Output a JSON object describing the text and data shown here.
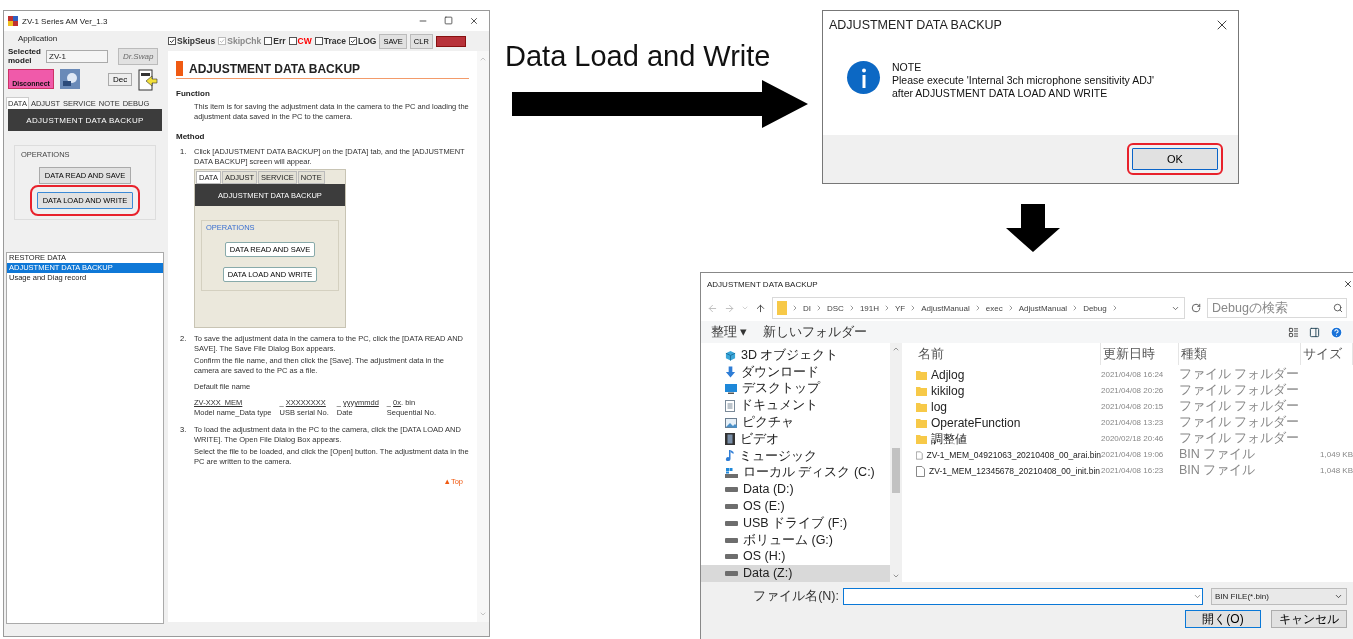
{
  "main_window": {
    "title": "ZV-1 Series AM Ver_1.3",
    "menu": [
      "Application"
    ],
    "model_label": "Selected model",
    "model_value": "ZV-1",
    "swap_button": {
      "label": "Dr.Swap",
      "disabled": true
    },
    "connect_button": "Disconnect",
    "dec_button": "Dec",
    "tabs": [
      {
        "label": "DATA",
        "selected": true
      },
      {
        "label": "ADJUST",
        "selected": false
      },
      {
        "label": "SERVICE",
        "selected": false
      },
      {
        "label": "NOTE",
        "selected": false
      },
      {
        "label": "DEBUG",
        "selected": false
      }
    ],
    "panel_header": "ADJUSTMENT DATA BACKUP",
    "group_label": "OPERATIONS",
    "operations": [
      {
        "label": "DATA READ AND SAVE",
        "highlighted": false
      },
      {
        "label": "DATA LOAD AND WRITE",
        "highlighted": true
      }
    ],
    "items": [
      {
        "label": "RESTORE DATA",
        "selected": false
      },
      {
        "label": "ADJUSTMENT DATA BACKUP",
        "selected": true
      },
      {
        "label": "Usage and Diag record",
        "selected": false
      }
    ],
    "options": [
      {
        "label": "SkipSeus",
        "checked": true,
        "disabled": false,
        "color": "#333333"
      },
      {
        "label": "SkipChk",
        "checked": true,
        "disabled": true,
        "color": "#888888"
      },
      {
        "label": "Err",
        "checked": false,
        "disabled": false,
        "color": "#333333"
      },
      {
        "label": "CW",
        "checked": false,
        "disabled": false,
        "color": "#ff0000"
      },
      {
        "label": "Trace",
        "checked": false,
        "disabled": false,
        "color": "#333333"
      },
      {
        "label": "LOG",
        "checked": true,
        "disabled": false,
        "color": "#333333"
      }
    ],
    "tool_buttons": [
      "SAVE",
      "CLR"
    ],
    "document": {
      "heading": "ADJUSTMENT DATA BACKUP",
      "function_title": "Function",
      "function_text": "This item is for saving the adjustment data in the camera to the PC and loading the adjustment data saved in the PC to the camera.",
      "method_title": "Method",
      "step1": {
        "number": "1.",
        "text": "Click [ADJUSTMENT DATA BACKUP] on the [DATA] tab, and the [ADJUSTMENT DATA BACKUP] screen will appear."
      },
      "inset": {
        "tabs": [
          {
            "label": "DATA",
            "selected": true
          },
          {
            "label": "ADJUST",
            "selected": false
          },
          {
            "label": "SERVICE",
            "selected": false
          },
          {
            "label": "NOTE",
            "selected": false
          }
        ],
        "header": "ADJUSTMENT DATA BACKUP",
        "group_label": "OPERATIONS",
        "buttons": [
          "DATA READ AND SAVE",
          "DATA LOAD AND WRITE"
        ]
      },
      "step2": {
        "number": "2.",
        "paragraphs": [
          "To save the adjustment data in the camera to the PC, click the [DATA READ AND SAVE]. The Save File Dialog Box appears.",
          "Confirm the file name, and then click the [Save]. The adjustment data in the camera are saved to the PC as a file."
        ]
      },
      "default_name_label": "Default file name",
      "name_parts": [
        {
          "value": "ZV-XXX_MEM",
          "caption": "Model name_Data type"
        },
        {
          "prefix": "_",
          "value": "XXXXXXXX",
          "caption": "USB serial No."
        },
        {
          "prefix": "_",
          "value": "yyyymmdd",
          "caption": "Date"
        },
        {
          "prefix": "_",
          "value": "0x",
          "suffix": ". bin",
          "caption": "Sequential No."
        }
      ],
      "step3": {
        "number": "3.",
        "paragraphs": [
          "To load the adjustment data in the PC to the camera, click the [DATA LOAD AND WRITE]. The Open File Dialog Box appears.",
          "Select the file to be loaded, and click the [Open] button. The adjustment data in the PC are written to the camera."
        ]
      },
      "top_link": "▲Top"
    }
  },
  "caption": "Data Load and Write",
  "note_dialog": {
    "title": "ADJUSTMENT DATA BACKUP",
    "heading": "NOTE",
    "lines": [
      "Please execute 'Internal 3ch microphone sensitivity ADJ'",
      "after ADJUSTMENT DATA LOAD AND WRITE"
    ],
    "ok_button": {
      "label": "OK",
      "highlighted": true
    }
  },
  "file_dialog": {
    "title": "ADJUSTMENT DATA BACKUP",
    "path": [
      "DI",
      "DSC",
      "191H",
      "YF",
      "AdjustManual",
      "exec",
      "AdjustManual",
      "Debug"
    ],
    "search": {
      "placeholder": "Debugの検索"
    },
    "organize": "整理 ▾",
    "new_folder": "新しいフォルダー",
    "tree": [
      {
        "label": "3D オブジェクト",
        "kind": "cube",
        "selected": false
      },
      {
        "label": "ダウンロード",
        "kind": "download",
        "selected": false
      },
      {
        "label": "デスクトップ",
        "kind": "desktop",
        "selected": false
      },
      {
        "label": "ドキュメント",
        "kind": "document",
        "selected": false
      },
      {
        "label": "ピクチャ",
        "kind": "picture",
        "selected": false
      },
      {
        "label": "ビデオ",
        "kind": "video",
        "selected": false
      },
      {
        "label": "ミュージック",
        "kind": "music",
        "selected": false
      },
      {
        "label": "ローカル ディスク (C:)",
        "kind": "system",
        "selected": false
      },
      {
        "label": "Data (D:)",
        "kind": "drive",
        "selected": false
      },
      {
        "label": "OS (E:)",
        "kind": "drive",
        "selected": false
      },
      {
        "label": "USB ドライブ (F:)",
        "kind": "drive",
        "selected": false
      },
      {
        "label": "ボリューム (G:)",
        "kind": "drive",
        "selected": false
      },
      {
        "label": "OS (H:)",
        "kind": "drive",
        "selected": false
      },
      {
        "label": "Data (Z:)",
        "kind": "drive",
        "selected": true
      }
    ],
    "columns": [
      "名前",
      "更新日時",
      "種類",
      "サイズ"
    ],
    "files": [
      {
        "name": "Adjlog",
        "kind": "folder",
        "date": "2021/04/08 16:24",
        "type": "ファイル フォルダー"
      },
      {
        "name": "kikilog",
        "kind": "folder",
        "date": "2021/04/08 20:26",
        "type": "ファイル フォルダー"
      },
      {
        "name": "log",
        "kind": "folder",
        "date": "2021/04/08 20:15",
        "type": "ファイル フォルダー"
      },
      {
        "name": "OperateFunction",
        "kind": "folder",
        "date": "2021/04/08 13:23",
        "type": "ファイル フォルダー"
      },
      {
        "name": "調整値",
        "kind": "folder",
        "date": "2020/02/18 20:46",
        "type": "ファイル フォルダー"
      },
      {
        "name": "ZV-1_MEM_04921063_20210408_00_arai.bin",
        "kind": "file",
        "date": "2021/04/08 19:06",
        "type": "BIN ファイル",
        "size": "1,049 KB"
      },
      {
        "name": "ZV-1_MEM_12345678_20210408_00_init.bin",
        "kind": "file",
        "date": "2021/04/08 16:23",
        "type": "BIN ファイル",
        "size": "1,048 KB"
      }
    ],
    "filename_label": "ファイル名(N):",
    "filter": "BIN FILE(*.bin)",
    "open_button": "開く(O)",
    "cancel_button": "キャンセル"
  }
}
